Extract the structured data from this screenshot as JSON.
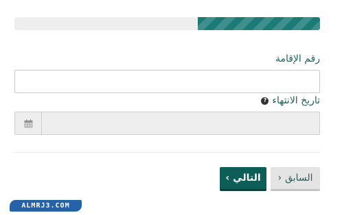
{
  "progress": {
    "fraction": 0.4,
    "color": "#1a7b77"
  },
  "form": {
    "iqama_label": "رقم الإقامة",
    "iqama_value": "",
    "expiry_label": "تاريخ الانتهاء",
    "expiry_help_icon": "question-circle-icon",
    "expiry_help_glyph": "?",
    "expiry_value": "",
    "calendar_icon": "calendar-icon"
  },
  "buttons": {
    "previous_label": "السابق",
    "previous_chevron": "‹",
    "next_label": "التالي",
    "next_chevron": "›",
    "next_color": "#0d5e59",
    "previous_color": "#e4e4e4"
  },
  "watermark": {
    "text": "ALMRJ3.COM",
    "color": "#2662a8"
  }
}
